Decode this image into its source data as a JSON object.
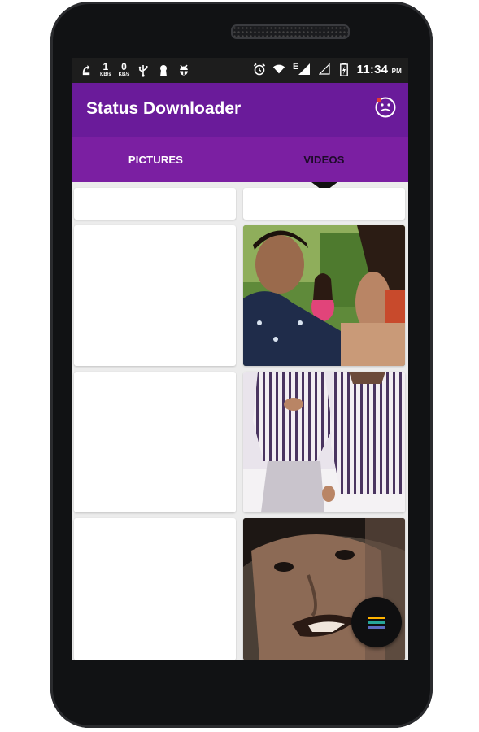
{
  "status_bar": {
    "left_icons": [
      "notification-icon",
      "data-speed-up",
      "data-speed-down",
      "usb-icon",
      "keyhole-icon",
      "android-debug-icon"
    ],
    "speed_up": {
      "value": "1",
      "unit": "KB/s"
    },
    "speed_down": {
      "value": "0",
      "unit": "KB/s"
    },
    "right_icons": [
      "alarm-icon",
      "wifi-icon",
      "signal-icon",
      "battery-icon"
    ],
    "network_type": "E",
    "time": "11:34",
    "ampm": "PM"
  },
  "app_bar": {
    "title": "Status Downloader",
    "action_icon": "emoji-face-icon"
  },
  "tabs": [
    {
      "label": "PICTURES",
      "selected": false
    },
    {
      "label": "VIDEOS",
      "selected": true
    }
  ],
  "colors": {
    "app_bar": "#6a1b9a",
    "tab_bar": "#7b1fa2",
    "status_bar": "#1d1d1d",
    "fab": "#0f0f10",
    "fab_lines": [
      "#ffb300",
      "#26a69a",
      "#5c6bc0"
    ]
  },
  "grid": {
    "left_column": [
      "empty",
      "empty",
      "empty",
      "empty"
    ],
    "right_column": [
      "empty",
      "video-thumbnail-couple",
      "video-thumbnail-striped-shirts",
      "video-thumbnail-closeup-face"
    ]
  },
  "fab": {
    "icon": "menu-lines-icon"
  }
}
